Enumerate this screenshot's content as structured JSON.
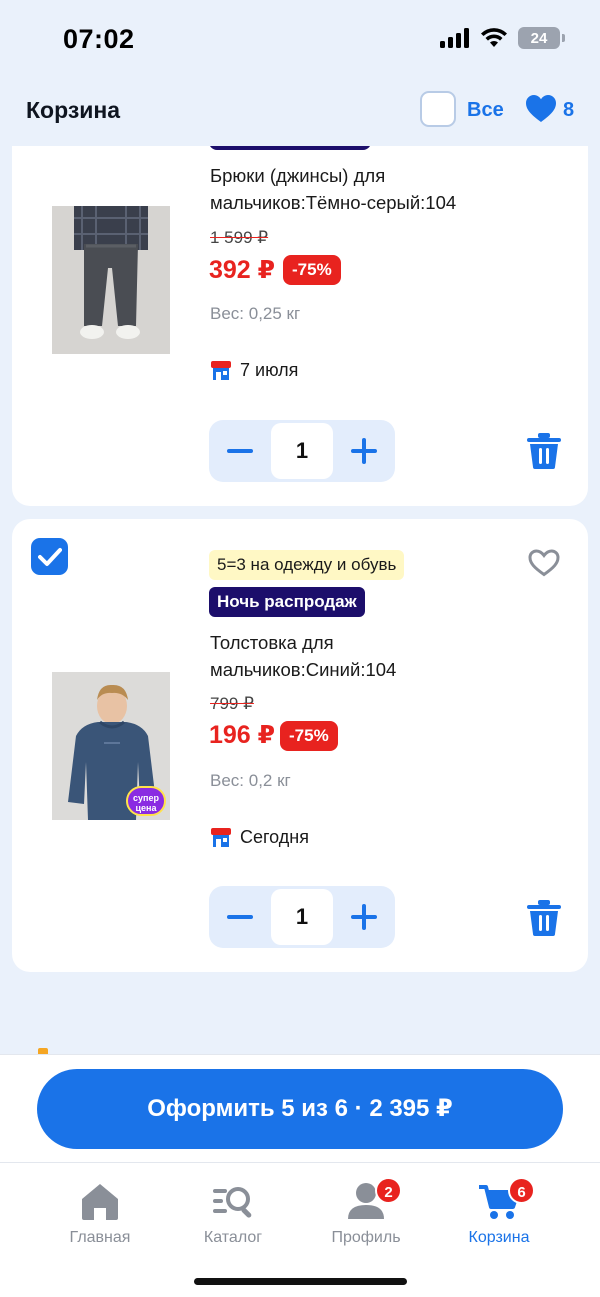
{
  "status_bar": {
    "time": "07:02",
    "battery": "24"
  },
  "header": {
    "title": "Корзина",
    "select_all_label": "Все",
    "favorites_count": "8"
  },
  "items": [
    {
      "name": "Брюки (джинсы) для мальчиков:Тёмно-серый:104",
      "old_price": "1 599 ₽",
      "price": "392 ₽",
      "discount": "-75%",
      "weight": "Вес: 0,25 кг",
      "delivery": "7 июля",
      "quantity": "1",
      "checked": true
    },
    {
      "promo": "5=3 на одежду и обувь",
      "sale_tag": "Ночь распродаж",
      "name": "Толстовка для мальчиков:Синий:104",
      "old_price": "799 ₽",
      "price": "196 ₽",
      "discount": "-75%",
      "weight": "Вес: 0,2 кг",
      "delivery": "Сегодня",
      "quantity": "1",
      "badge": "супер цена",
      "checked": true
    }
  ],
  "checkout": {
    "label": "Оформить 5 из 6 · 2 395 ₽"
  },
  "tabbar": [
    {
      "label": "Главная",
      "icon": "home-icon"
    },
    {
      "label": "Каталог",
      "icon": "catalog-icon"
    },
    {
      "label": "Профиль",
      "icon": "profile-icon",
      "badge": "2"
    },
    {
      "label": "Корзина",
      "icon": "cart-icon",
      "badge": "6",
      "active": true
    }
  ],
  "colors": {
    "accent": "#1a73e8",
    "sale": "#e8231f",
    "promo_dark": "#1c0e6b",
    "background": "#eaf1fb"
  }
}
